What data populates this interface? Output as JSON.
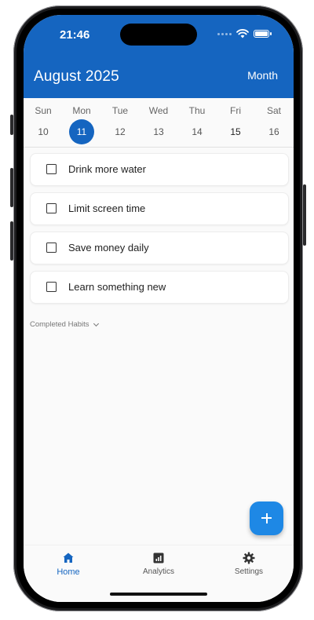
{
  "status_bar": {
    "time": "21:46"
  },
  "header": {
    "title": "August 2025",
    "view_toggle": "Month"
  },
  "week": [
    {
      "name": "Sun",
      "date": "10"
    },
    {
      "name": "Mon",
      "date": "11"
    },
    {
      "name": "Tue",
      "date": "12"
    },
    {
      "name": "Wed",
      "date": "13"
    },
    {
      "name": "Thu",
      "date": "14"
    },
    {
      "name": "Fri",
      "date": "15"
    },
    {
      "name": "Sat",
      "date": "16"
    }
  ],
  "habits": [
    {
      "label": "Drink more water"
    },
    {
      "label": "Limit screen time"
    },
    {
      "label": "Save money daily"
    },
    {
      "label": "Learn something new"
    }
  ],
  "completed_section": {
    "label": "Completed Habits"
  },
  "fab": {
    "label": "+"
  },
  "nav": {
    "home": "Home",
    "analytics": "Analytics",
    "settings": "Settings"
  },
  "colors": {
    "primary": "#1565c0",
    "fab": "#1e88e5",
    "background": "#fafafa"
  },
  "icons": [
    "home-icon",
    "analytics-icon",
    "settings-icon",
    "plus-icon",
    "wifi-icon",
    "battery-icon",
    "checkbox-icon"
  ]
}
